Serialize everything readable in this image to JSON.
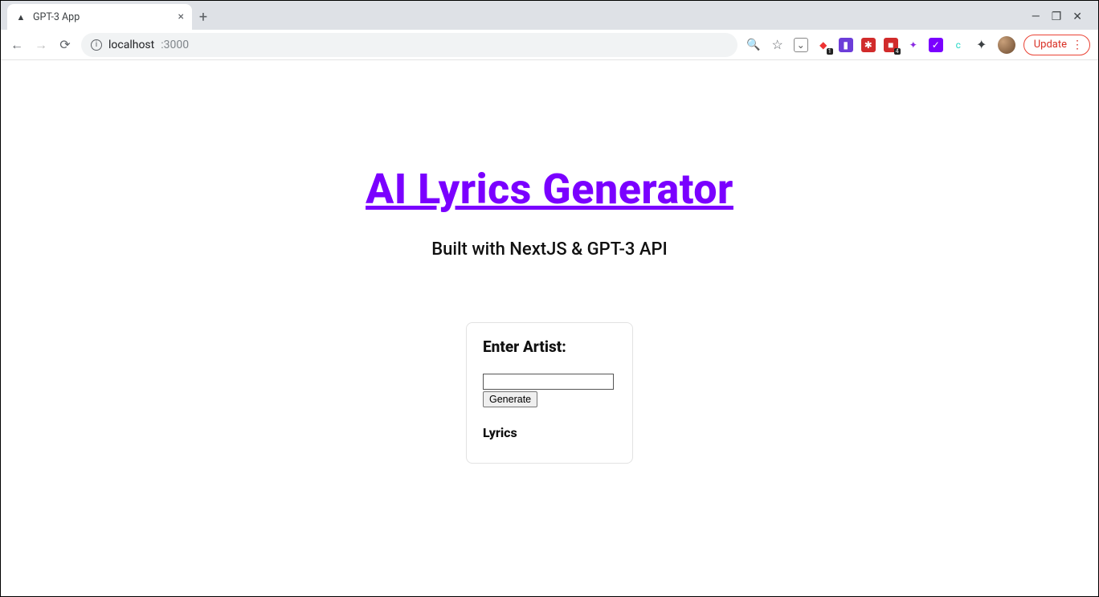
{
  "browser": {
    "tab_title": "GPT-3 App",
    "url_host": "localhost",
    "url_port": ":3000",
    "update_label": "Update"
  },
  "page": {
    "title": "AI Lyrics Generator",
    "subtitle": "Built with NextJS & GPT-3 API",
    "card": {
      "heading": "Enter Artist:",
      "artist_value": "",
      "generate_label": "Generate",
      "lyrics_heading": "Lyrics"
    }
  },
  "ext_badges": {
    "first": "1",
    "fourth": "4"
  }
}
